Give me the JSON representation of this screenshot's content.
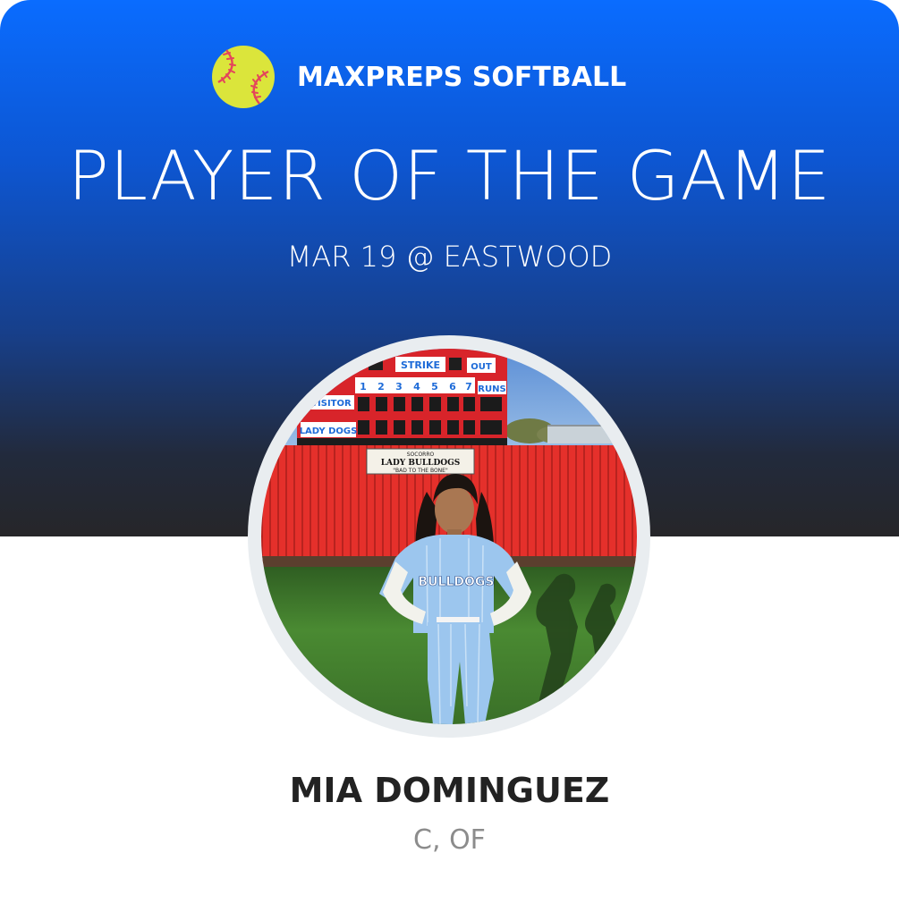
{
  "header": {
    "brand": "MAXPREPS SOFTBALL",
    "brand_icon": "softball-icon",
    "title": "PLAYER OF THE GAME",
    "subtitle": "MAR 19 @ EASTWOOD"
  },
  "photo": {
    "scoreboard": {
      "strike": "STRIKE",
      "out": "OUT",
      "innings": [
        "1",
        "2",
        "3",
        "4",
        "5",
        "6",
        "7"
      ],
      "runs": "RUNS",
      "visitor": "VISITOR",
      "home": "LADY DOGS"
    },
    "sign": {
      "line1": "SOCORRO",
      "line2": "LADY BULLDOGS",
      "line3": "\"BAD TO THE BONE\""
    },
    "jersey_text": "BULLDOGS"
  },
  "player": {
    "name": "MIA DOMINGUEZ",
    "position": "C, OF"
  },
  "colors": {
    "header_top": "#0a6cff",
    "header_bottom": "#262629",
    "softball": "#dbe53b",
    "stitch": "#e4455b",
    "wall": "#e5302b",
    "grass": "#3f7b2c",
    "uniform": "#9cc6ee"
  }
}
